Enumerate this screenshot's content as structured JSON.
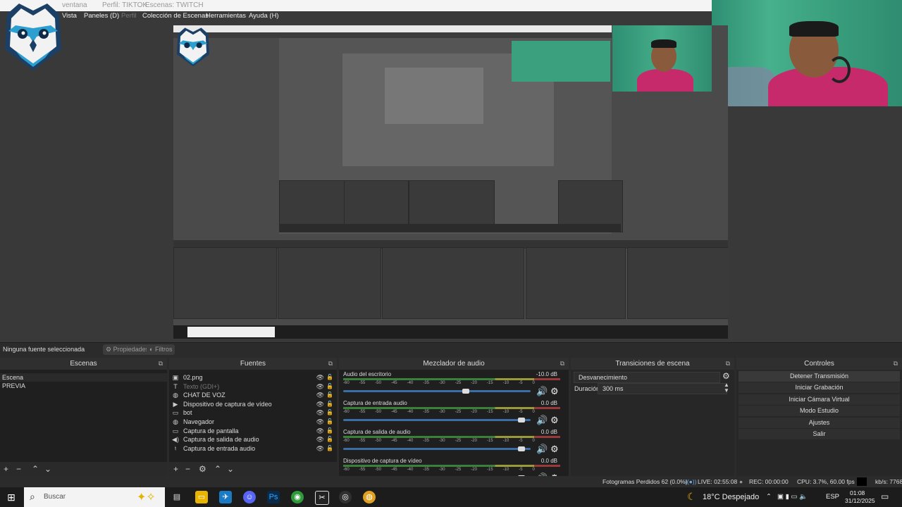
{
  "menu": {
    "top_items": [
      "ventana",
      "Perfil: TIKTOK",
      "Escenas: TWITCH"
    ],
    "items": [
      {
        "label": "Vista",
        "dim": false
      },
      {
        "label": "Paneles (D)",
        "dim": false
      },
      {
        "label": "Perfil",
        "dim": true
      },
      {
        "label": "Colección de Escenas",
        "dim": false
      },
      {
        "label": "Herramientas",
        "dim": false
      },
      {
        "label": "Ayuda (H)",
        "dim": false
      }
    ]
  },
  "source_bar": {
    "no_source": "Ninguna fuente seleccionada",
    "properties": "Propiedades",
    "filters": "Filtros"
  },
  "scenes": {
    "title": "Escenas",
    "items": [
      "Escena",
      "PREVIA"
    ]
  },
  "sources": {
    "title": "Fuentes",
    "items": [
      {
        "label": "02.png",
        "icon": "image-icon",
        "dim": false
      },
      {
        "label": "Texto (GDI+)",
        "icon": "text-icon",
        "dim": true
      },
      {
        "label": "CHAT DE VOZ",
        "icon": "globe-icon",
        "dim": false
      },
      {
        "label": "Dispositivo de captura de vídeo",
        "icon": "camera-icon",
        "dim": false
      },
      {
        "label": "bot",
        "icon": "window-icon",
        "dim": false
      },
      {
        "label": "Navegador",
        "icon": "globe-icon",
        "dim": false
      },
      {
        "label": "Captura de pantalla",
        "icon": "monitor-icon",
        "dim": false
      },
      {
        "label": "Captura de salida de audio",
        "icon": "speaker-icon",
        "dim": false
      },
      {
        "label": "Captura de entrada audio",
        "icon": "mic-icon",
        "dim": false
      }
    ]
  },
  "mixer": {
    "title": "Mezclador de audio",
    "ticks": [
      "-60",
      "-55",
      "-50",
      "-45",
      "-40",
      "-35",
      "-30",
      "-25",
      "-20",
      "-15",
      "-10",
      "-5",
      "0"
    ],
    "channels": [
      {
        "name": "Audio del escritorio",
        "db": "-10.0 dB",
        "level": 0.66
      },
      {
        "name": "Captura de entrada audio",
        "db": "0.0 dB",
        "level": 0.97
      },
      {
        "name": "Captura de salida de audio",
        "db": "0.0 dB",
        "level": 0.97
      },
      {
        "name": "Dispositivo de captura de vídeo",
        "db": "0.0 dB",
        "level": 0.97
      }
    ]
  },
  "transitions": {
    "title": "Transiciones de escena",
    "selected": "Desvanecimiento",
    "duration_label": "Duración",
    "duration_value": "300 ms"
  },
  "controls": {
    "title": "Controles",
    "buttons": [
      "Detener Transmisión",
      "Iniciar Grabación",
      "Iniciar Cámara Virtual",
      "Modo Estudio",
      "Ajustes",
      "Salir"
    ]
  },
  "status": {
    "dropped": "Fotogramas Perdidos 62 (0.0%)",
    "live": "LIVE: 02:55:08",
    "rec": "REC: 00:00:00",
    "cpu": "CPU: 3.7%, 60.00 fps",
    "kbs": "kb/s: 7768"
  },
  "taskbar": {
    "search_placeholder": "Buscar",
    "weather": "18°C  Despejado",
    "lang": "ESP",
    "time": "01:08",
    "date": "31/12/2025"
  },
  "colors": {
    "accent_slider": "#3a6ea5",
    "webcam_wall": "#3aa07e",
    "shirt": "#c72a6b"
  }
}
